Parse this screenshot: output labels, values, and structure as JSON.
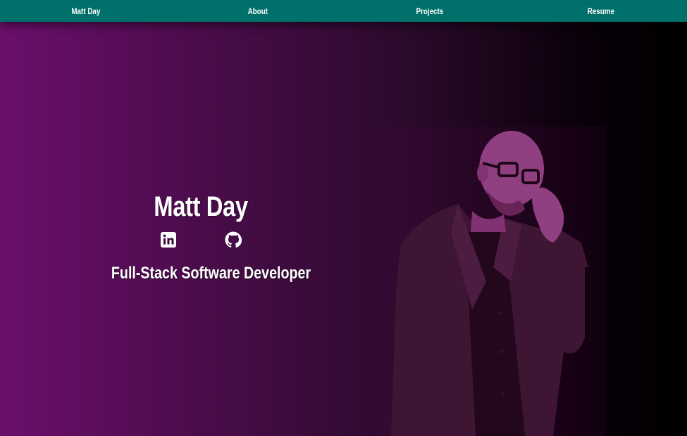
{
  "nav": {
    "items": [
      {
        "label": "Matt Day"
      },
      {
        "label": "About"
      },
      {
        "label": "Projects"
      },
      {
        "label": "Resume"
      }
    ]
  },
  "hero": {
    "name": "Matt Day",
    "tagline": "Full-Stack Software Developer",
    "social": [
      {
        "icon": "linkedin-icon"
      },
      {
        "icon": "github-icon"
      }
    ]
  },
  "colors": {
    "nav_bg": "#00706b",
    "gradient_left": "#6b0f6b",
    "gradient_right": "#000000",
    "portrait_tint": "#8a3a7a"
  },
  "portrait": {
    "alt": "portrait photo"
  }
}
